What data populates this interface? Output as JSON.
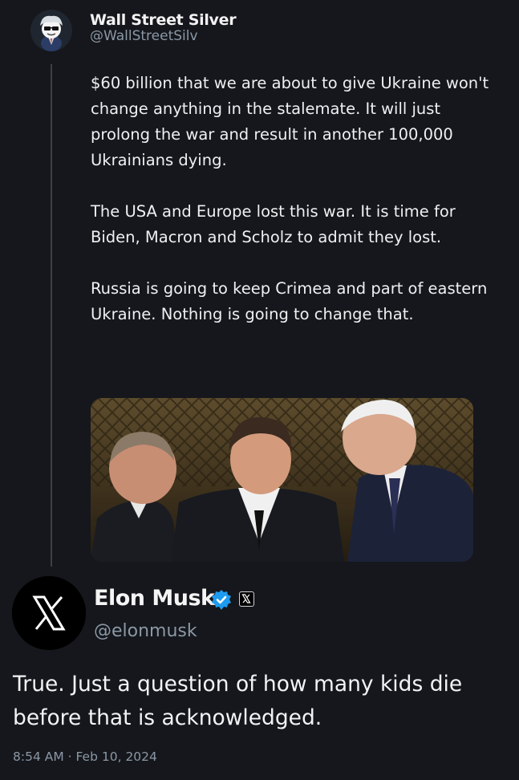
{
  "quoted_tweet": {
    "author_name": "Wall Street Silver",
    "author_handle": "@WallStreetSilv",
    "paragraphs": [
      "$60 billion that we are about to give Ukraine won't change anything in the stalemate. It will just prolong the war and result in another 100,000 Ukrainians dying.",
      "The USA and Europe lost this war. It is time for Biden, Macron and Scholz to admit they lost.",
      "Russia is going to keep Crimea and part of eastern Ukraine. Nothing is going to change that."
    ],
    "image": "photo of three men in suits talking in an ornate room"
  },
  "reply_tweet": {
    "author_name": "Elon Musk",
    "author_handle": "@elonmusk",
    "verified_icon": "verified-badge-icon",
    "affiliate_icon": "x-logo-icon",
    "text": "True. Just a question of how many kids die before that is acknowledged.",
    "timestamp": "8:54 AM · Feb 10, 2024"
  },
  "colors": {
    "background": "#15171c",
    "text": "#e7e9ea",
    "secondary_text": "#8b98a5",
    "verified_blue": "#1d9bf0"
  }
}
